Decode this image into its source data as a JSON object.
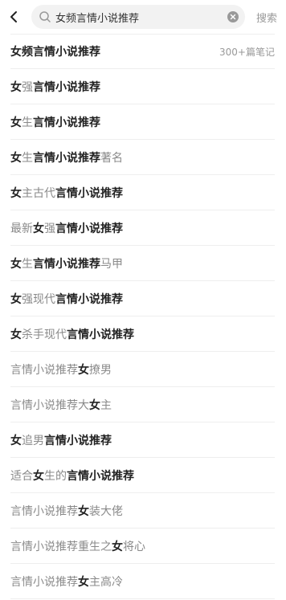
{
  "header": {
    "query": "女频言情小说推荐",
    "cancel_label": "搜索"
  },
  "suggestions": [
    {
      "parts": [
        {
          "t": "女频言情小说推荐",
          "h": true
        }
      ],
      "note": "300+篇笔记"
    },
    {
      "parts": [
        {
          "t": "女",
          "h": true
        },
        {
          "t": "强",
          "h": false
        },
        {
          "t": "言情小说推荐",
          "h": true
        }
      ]
    },
    {
      "parts": [
        {
          "t": "女",
          "h": true
        },
        {
          "t": "生",
          "h": false
        },
        {
          "t": "言情小说推荐",
          "h": true
        }
      ]
    },
    {
      "parts": [
        {
          "t": "女",
          "h": true
        },
        {
          "t": "生",
          "h": false
        },
        {
          "t": "言情小说推荐",
          "h": true
        },
        {
          "t": "著名",
          "h": false
        }
      ]
    },
    {
      "parts": [
        {
          "t": "女",
          "h": true
        },
        {
          "t": "主古代",
          "h": false
        },
        {
          "t": "言情小说推荐",
          "h": true
        }
      ]
    },
    {
      "parts": [
        {
          "t": "最新",
          "h": false
        },
        {
          "t": "女",
          "h": true
        },
        {
          "t": "强",
          "h": false
        },
        {
          "t": "言情小说推荐",
          "h": true
        }
      ]
    },
    {
      "parts": [
        {
          "t": "女",
          "h": true
        },
        {
          "t": "生",
          "h": false
        },
        {
          "t": "言情小说推荐",
          "h": true
        },
        {
          "t": "马甲",
          "h": false
        }
      ]
    },
    {
      "parts": [
        {
          "t": "女",
          "h": true
        },
        {
          "t": "强现代",
          "h": false
        },
        {
          "t": "言情小说推荐",
          "h": true
        }
      ]
    },
    {
      "parts": [
        {
          "t": "女",
          "h": true
        },
        {
          "t": "杀手现代",
          "h": false
        },
        {
          "t": "言情小说推荐",
          "h": true
        }
      ]
    },
    {
      "parts": [
        {
          "t": "言情小说推荐",
          "h": false
        },
        {
          "t": "女",
          "h": true
        },
        {
          "t": "撩男",
          "h": false
        }
      ]
    },
    {
      "parts": [
        {
          "t": "言情小说推荐大",
          "h": false
        },
        {
          "t": "女",
          "h": true
        },
        {
          "t": "主",
          "h": false
        }
      ]
    },
    {
      "parts": [
        {
          "t": "女",
          "h": true
        },
        {
          "t": "追男",
          "h": false
        },
        {
          "t": "言情小说推荐",
          "h": true
        }
      ]
    },
    {
      "parts": [
        {
          "t": "适合",
          "h": false
        },
        {
          "t": "女",
          "h": true
        },
        {
          "t": "生的",
          "h": false
        },
        {
          "t": "言情小说推荐",
          "h": true
        }
      ]
    },
    {
      "parts": [
        {
          "t": "言情小说推荐",
          "h": false
        },
        {
          "t": "女",
          "h": true
        },
        {
          "t": "装大佬",
          "h": false
        }
      ]
    },
    {
      "parts": [
        {
          "t": "言情小说推荐重生之",
          "h": false
        },
        {
          "t": "女",
          "h": true
        },
        {
          "t": "将心",
          "h": false
        }
      ]
    },
    {
      "parts": [
        {
          "t": "言情小说推荐",
          "h": false
        },
        {
          "t": "女",
          "h": true
        },
        {
          "t": "主高冷",
          "h": false
        }
      ]
    }
  ],
  "icons": {
    "back": "chevron-left-icon",
    "search": "search-icon",
    "clear": "clear-circle-icon"
  }
}
